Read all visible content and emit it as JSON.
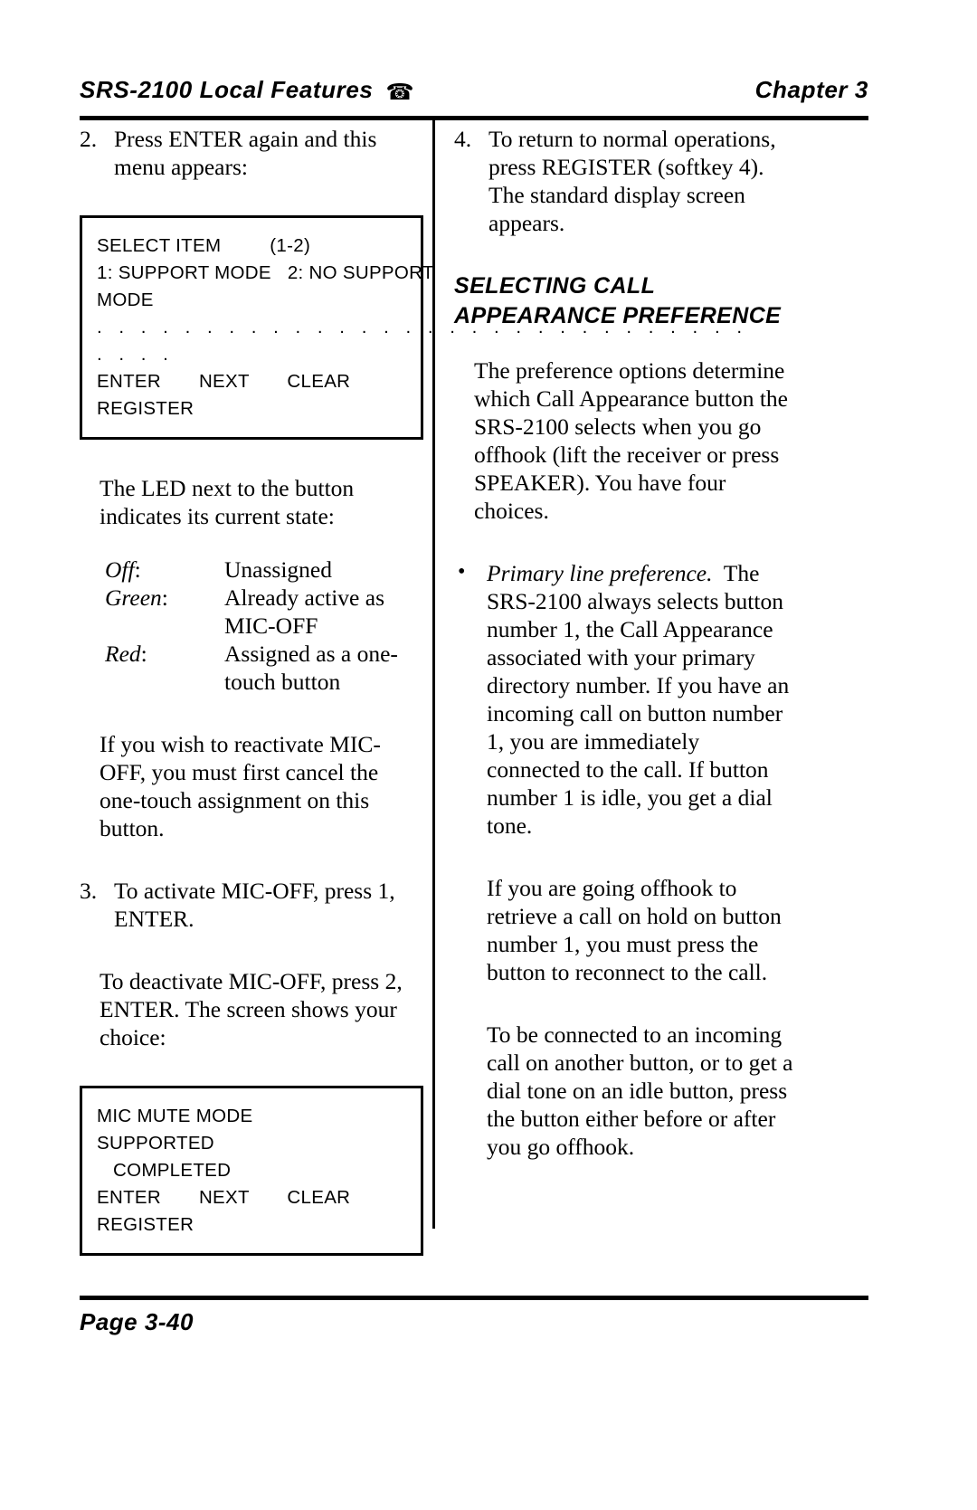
{
  "header": {
    "title": "SRS-2100 Local Features",
    "phone_icon": "☎",
    "chapter": "Chapter 3"
  },
  "left_column": {
    "step2": {
      "number": "2.",
      "text": "Press ENTER again and this menu appears:"
    },
    "lcd_select_item": {
      "lines": [
        "SELECT ITEM         (1-2)",
        "1: SUPPORT MODE   2: NO SUPPORT",
        "MODE",
        ". . . . . . . . . . . . . . . . . . . . . . . . . . . . . .",
        ". . . .",
        "ENTER       NEXT       CLEAR",
        "REGISTER"
      ]
    },
    "led_intro": "The LED next to the button indicates its current state:",
    "led_states": [
      {
        "term": "Off",
        "desc": "Unassigned"
      },
      {
        "term": "Green",
        "desc": "Already active as MIC-OFF"
      },
      {
        "term": "Red",
        "desc": "Assigned as a one-touch button"
      }
    ],
    "reactivate_note": "If you wish to reactivate MIC-OFF, you must first cancel the one-touch assignment on this button.",
    "step3": {
      "number": "3.",
      "text": "To activate MIC-OFF, press 1, ENTER."
    },
    "deactivate_note": "To deactivate MIC-OFF, press 2, ENTER.  The screen shows your choice:",
    "lcd_mic_mute": {
      "lines": [
        "MIC MUTE MODE",
        "SUPPORTED",
        "   COMPLETED",
        "ENTER       NEXT       CLEAR",
        "REGISTER"
      ]
    }
  },
  "right_column": {
    "step4": {
      "number": "4.",
      "text": "To return to normal operations, press REGISTER (softkey 4).  The standard display screen appears."
    },
    "section_heading_line1": "SELECTING CALL",
    "section_heading_line2": "APPEARANCE PREFERENCE",
    "intro": "The preference options determine which Call Appearance button the SRS-2100 selects when you go offhook (lift the receiver or press SPEAKER).  You have four choices.",
    "bullet": {
      "marker": "•",
      "lead_italic": "Primary line preference.",
      "body": "The SRS-2100 always selects button number 1, the Call Appearance associated with your primary directory number.  If you have an incoming call on button number 1, you are immediately connected to the call.  If button number 1 is idle, you get a dial tone."
    },
    "para_hold": "If you are going offhook to retrieve a call on hold on button number 1, you must press the button to reconnect to the call.",
    "para_connect": "To be connected to an incoming call on another button, or to get a dial tone on an idle button, press the button either before or after you go offhook."
  },
  "footer": {
    "page_label": "Page 3-40"
  }
}
